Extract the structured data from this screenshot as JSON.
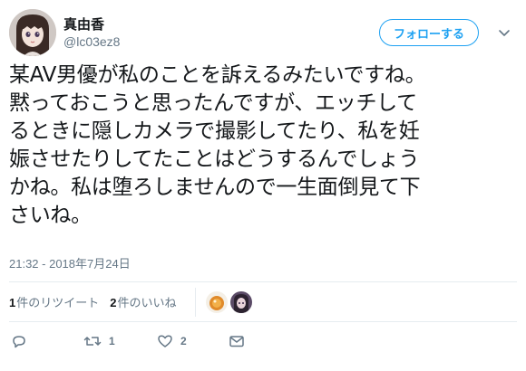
{
  "user": {
    "name": "真由香",
    "handle": "@lc03ez8",
    "follow_label": "フォローする"
  },
  "tweet": {
    "text": "某AV男優が私のことを訴えるみたいですね。\n黙っておこうと思ったんですが、エッチして\nるときに隠しカメラで撮影してたり、私を妊\n娠させたりしてたことはどうするんでしょう\nかね。私は堕ろしませんので一生面倒見て下\nさいね。",
    "timestamp": "21:32 - 2018年7月24日"
  },
  "stats": {
    "retweets_count": "1",
    "retweets_label": "件のリツイート",
    "likes_count": "2",
    "likes_label": "件のいいね"
  },
  "actions": {
    "reply_count": "",
    "retweet_count": "1",
    "like_count": "2"
  },
  "icons": {
    "avatar": "doll-avatar",
    "reply": "reply-icon",
    "retweet": "retweet-icon",
    "like": "heart-icon",
    "dm": "envelope-icon",
    "caret": "chevron-down-icon"
  },
  "colors": {
    "accent": "#1da1f2",
    "secondary_text": "#657786",
    "divider": "#e6ecf0"
  }
}
